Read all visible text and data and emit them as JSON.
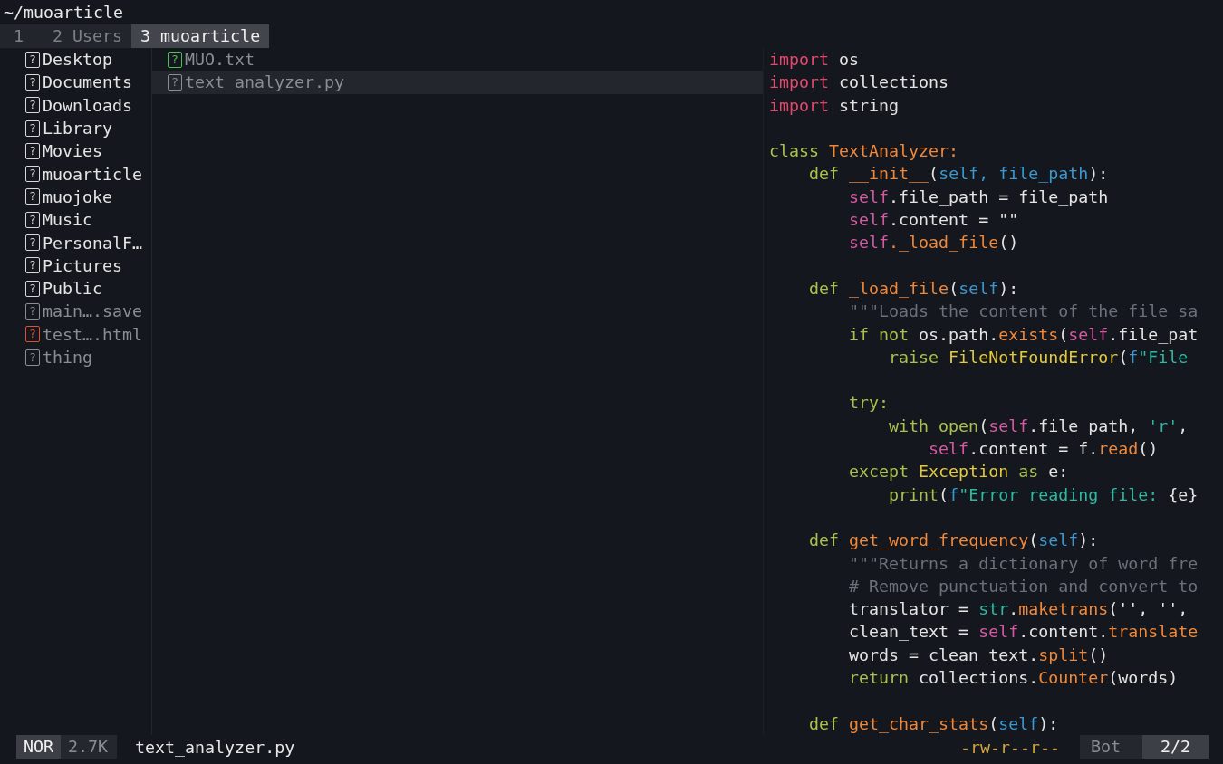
{
  "path": "~/muoarticle",
  "tabs": [
    {
      "label": "1",
      "selected": false
    },
    {
      "label": "2 Users",
      "selected": false
    },
    {
      "label": "3 muoarticle",
      "selected": true
    }
  ],
  "parent_column": [
    {
      "name": "Desktop",
      "kind": "dir",
      "icon": "?",
      "color": "#d8d8d8"
    },
    {
      "name": "Documents",
      "kind": "dir",
      "icon": "?",
      "color": "#d8d8d8"
    },
    {
      "name": "Downloads",
      "kind": "dir",
      "icon": "?",
      "color": "#d8d8d8"
    },
    {
      "name": "Library",
      "kind": "dir",
      "icon": "?",
      "color": "#d8d8d8"
    },
    {
      "name": "Movies",
      "kind": "dir",
      "icon": "?",
      "color": "#d8d8d8"
    },
    {
      "name": "muoarticle",
      "kind": "dir",
      "icon": "?",
      "color": "#d8d8d8"
    },
    {
      "name": "muojoke",
      "kind": "dir",
      "icon": "?",
      "color": "#d8d8d8"
    },
    {
      "name": "Music",
      "kind": "dir",
      "icon": "?",
      "color": "#d8d8d8"
    },
    {
      "name": "PersonalF…",
      "kind": "dir",
      "icon": "?",
      "color": "#d8d8d8"
    },
    {
      "name": "Pictures",
      "kind": "dir",
      "icon": "?",
      "color": "#d8d8d8"
    },
    {
      "name": "Public",
      "kind": "dir",
      "icon": "?",
      "color": "#d8d8d8"
    },
    {
      "name": "main….save",
      "kind": "file",
      "icon": "?",
      "color": "#8a8d93"
    },
    {
      "name": "test….html",
      "kind": "file",
      "icon": "?",
      "color": "#e0502e"
    },
    {
      "name": "thing",
      "kind": "file",
      "icon": "?",
      "color": "#8a8d93"
    }
  ],
  "current_column": [
    {
      "name": "MUO.txt",
      "icon": "?",
      "color": "#4cc04c",
      "selected": false
    },
    {
      "name": "text_analyzer.py",
      "icon": "?",
      "color": "#8a8d93",
      "selected": true
    }
  ],
  "preview": [
    {
      "kind": "code",
      "tokens": [
        {
          "text": "import",
          "kind": "imp"
        },
        {
          "text": " os",
          "kind": "plain"
        }
      ]
    },
    {
      "kind": "code",
      "tokens": [
        {
          "text": "import",
          "kind": "imp"
        },
        {
          "text": " collections",
          "kind": "plain"
        }
      ]
    },
    {
      "kind": "code",
      "tokens": [
        {
          "text": "import",
          "kind": "imp"
        },
        {
          "text": " string",
          "kind": "plain"
        }
      ]
    },
    {
      "kind": "blank"
    },
    {
      "kind": "code",
      "tokens": [
        {
          "text": "class",
          "kind": "key"
        },
        {
          "text": " TextAnalyzer:",
          "kind": "fn"
        }
      ]
    },
    {
      "kind": "code",
      "tokens": [
        {
          "text": "    def",
          "kind": "key"
        },
        {
          "text": " __init__",
          "kind": "fn"
        },
        {
          "text": "(",
          "kind": "plain"
        },
        {
          "text": "self, file_path",
          "kind": "param"
        },
        {
          "text": "):",
          "kind": "plain"
        }
      ]
    },
    {
      "kind": "code",
      "tokens": [
        {
          "text": "        self",
          "kind": "self"
        },
        {
          "text": ".file_path = file_path",
          "kind": "plain"
        }
      ]
    },
    {
      "kind": "code",
      "tokens": [
        {
          "text": "        self",
          "kind": "self"
        },
        {
          "text": ".content = \"\"",
          "kind": "plain"
        }
      ]
    },
    {
      "kind": "code",
      "tokens": [
        {
          "text": "        self",
          "kind": "self"
        },
        {
          "text": "._load_file",
          "kind": "fn"
        },
        {
          "text": "()",
          "kind": "plain"
        }
      ]
    },
    {
      "kind": "blank"
    },
    {
      "kind": "code",
      "tokens": [
        {
          "text": "    def",
          "kind": "key"
        },
        {
          "text": " _load_file",
          "kind": "fn"
        },
        {
          "text": "(",
          "kind": "plain"
        },
        {
          "text": "self",
          "kind": "param"
        },
        {
          "text": "):",
          "kind": "plain"
        }
      ]
    },
    {
      "kind": "code",
      "tokens": [
        {
          "text": "        \"\"\"Loads the content of the file sa",
          "kind": "doc"
        }
      ]
    },
    {
      "kind": "code",
      "tokens": [
        {
          "text": "        if not",
          "kind": "key"
        },
        {
          "text": " os.path.",
          "kind": "plain"
        },
        {
          "text": "exists",
          "kind": "fn"
        },
        {
          "text": "(",
          "kind": "plain"
        },
        {
          "text": "self",
          "kind": "self"
        },
        {
          "text": ".file_pat",
          "kind": "plain"
        }
      ]
    },
    {
      "kind": "code",
      "tokens": [
        {
          "text": "            raise",
          "kind": "key"
        },
        {
          "text": " FileNotFoundError",
          "kind": "exc"
        },
        {
          "text": "(",
          "kind": "plain"
        },
        {
          "text": "f",
          "kind": "param"
        },
        {
          "text": "\"File",
          "kind": "str"
        }
      ]
    },
    {
      "kind": "blank"
    },
    {
      "kind": "code",
      "tokens": [
        {
          "text": "        try:",
          "kind": "key"
        }
      ]
    },
    {
      "kind": "code",
      "tokens": [
        {
          "text": "            with open",
          "kind": "key"
        },
        {
          "text": "(",
          "kind": "plain"
        },
        {
          "text": "self",
          "kind": "self"
        },
        {
          "text": ".file_path, ",
          "kind": "plain"
        },
        {
          "text": "'r'",
          "kind": "str"
        },
        {
          "text": ",",
          "kind": "plain"
        }
      ]
    },
    {
      "kind": "code",
      "tokens": [
        {
          "text": "                self",
          "kind": "self"
        },
        {
          "text": ".content = f.",
          "kind": "plain"
        },
        {
          "text": "read",
          "kind": "fn"
        },
        {
          "text": "()",
          "kind": "plain"
        }
      ]
    },
    {
      "kind": "code",
      "tokens": [
        {
          "text": "        except",
          "kind": "key"
        },
        {
          "text": " Exception",
          "kind": "exc"
        },
        {
          "text": " as",
          "kind": "key"
        },
        {
          "text": " e:",
          "kind": "plain"
        }
      ]
    },
    {
      "kind": "code",
      "tokens": [
        {
          "text": "            print",
          "kind": "key"
        },
        {
          "text": "(",
          "kind": "plain"
        },
        {
          "text": "f",
          "kind": "param"
        },
        {
          "text": "\"Error reading file: ",
          "kind": "str"
        },
        {
          "text": "{e}",
          "kind": "plain"
        }
      ]
    },
    {
      "kind": "blank"
    },
    {
      "kind": "code",
      "tokens": [
        {
          "text": "    def",
          "kind": "key"
        },
        {
          "text": " get_word_frequency",
          "kind": "fn"
        },
        {
          "text": "(",
          "kind": "plain"
        },
        {
          "text": "self",
          "kind": "param"
        },
        {
          "text": "):",
          "kind": "plain"
        }
      ]
    },
    {
      "kind": "code",
      "tokens": [
        {
          "text": "        \"\"\"Returns a dictionary of word fre",
          "kind": "doc"
        }
      ]
    },
    {
      "kind": "code",
      "tokens": [
        {
          "text": "        # Remove punctuation and convert to",
          "kind": "doc"
        }
      ]
    },
    {
      "kind": "code",
      "tokens": [
        {
          "text": "        translator = ",
          "kind": "plain"
        },
        {
          "text": "str",
          "kind": "str"
        },
        {
          "text": ".",
          "kind": "plain"
        },
        {
          "text": "maketrans",
          "kind": "fn"
        },
        {
          "text": "('', '',",
          "kind": "plain"
        }
      ]
    },
    {
      "kind": "code",
      "tokens": [
        {
          "text": "        clean_text = ",
          "kind": "plain"
        },
        {
          "text": "self",
          "kind": "self"
        },
        {
          "text": ".content.",
          "kind": "plain"
        },
        {
          "text": "translate",
          "kind": "fn"
        }
      ]
    },
    {
      "kind": "code",
      "tokens": [
        {
          "text": "        words = clean_text.",
          "kind": "plain"
        },
        {
          "text": "split",
          "kind": "fn"
        },
        {
          "text": "()",
          "kind": "plain"
        }
      ]
    },
    {
      "kind": "code",
      "tokens": [
        {
          "text": "        return",
          "kind": "key"
        },
        {
          "text": " collections.",
          "kind": "plain"
        },
        {
          "text": "Counter",
          "kind": "fn"
        },
        {
          "text": "(words)",
          "kind": "plain"
        }
      ]
    },
    {
      "kind": "blank"
    },
    {
      "kind": "code",
      "tokens": [
        {
          "text": "    def",
          "kind": "key"
        },
        {
          "text": " get_char_stats",
          "kind": "fn"
        },
        {
          "text": "(",
          "kind": "plain"
        },
        {
          "text": "self",
          "kind": "param"
        },
        {
          "text": "):",
          "kind": "plain"
        }
      ]
    }
  ],
  "status_bar": {
    "mode": "NOR",
    "size": "2.7K",
    "file": "text_analyzer.py",
    "permissions": "-rw-r--r--",
    "position": "Bot",
    "count": "2/2"
  }
}
